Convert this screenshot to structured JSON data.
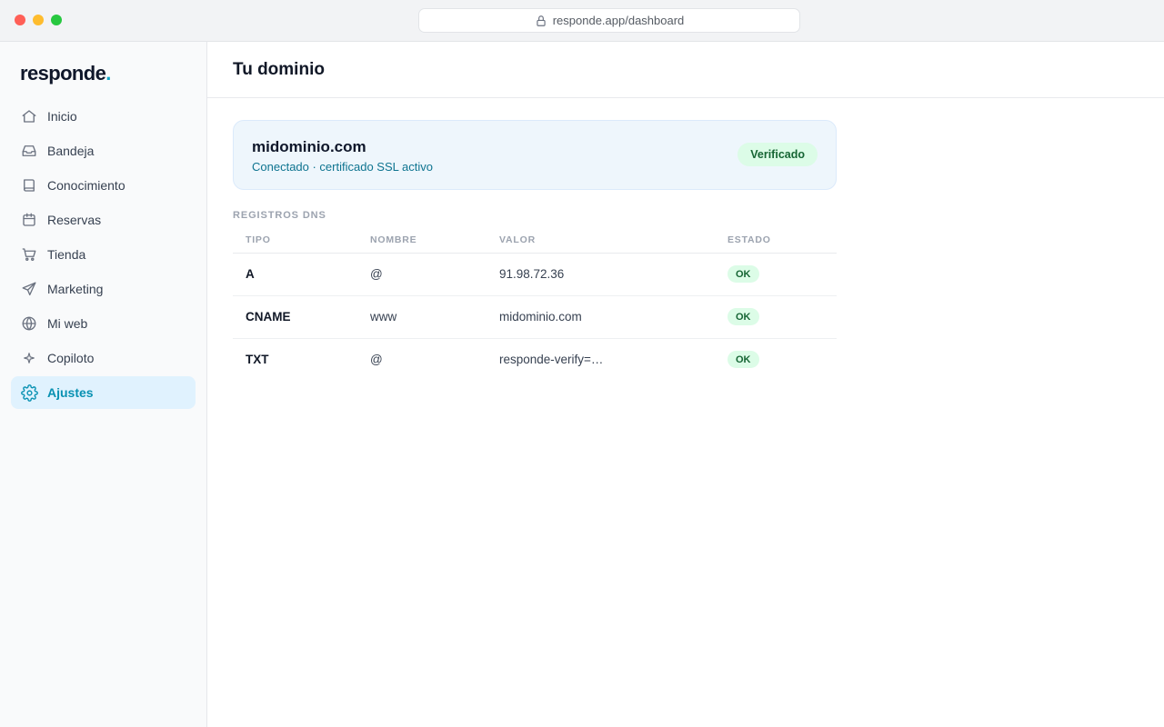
{
  "browser": {
    "url": "responde.app/dashboard",
    "lock_icon": "lock-icon"
  },
  "sidebar": {
    "logo": "responde",
    "logo_dot": ".",
    "items": [
      {
        "label": "Inicio",
        "icon": "home-icon"
      },
      {
        "label": "Bandeja",
        "icon": "inbox-icon"
      },
      {
        "label": "Conocimiento",
        "icon": "book-icon"
      },
      {
        "label": "Reservas",
        "icon": "calendar-icon"
      },
      {
        "label": "Tienda",
        "icon": "cart-icon"
      },
      {
        "label": "Marketing",
        "icon": "send-icon"
      },
      {
        "label": "Mi web",
        "icon": "globe-icon"
      },
      {
        "label": "Copiloto",
        "icon": "sparkle-icon"
      },
      {
        "label": "Ajustes",
        "icon": "gear-icon",
        "active": true
      }
    ]
  },
  "header": {
    "title": "Tu dominio"
  },
  "domain": {
    "name": "midominio.com",
    "status_text": "Conectado · certificado SSL activo",
    "badge": "Verificado"
  },
  "dns": {
    "section_title": "REGISTROS DNS",
    "columns": [
      "TIPO",
      "NOMBRE",
      "VALOR",
      "ESTADO"
    ],
    "rows": [
      {
        "type": "A",
        "name": "@",
        "value": "91.98.72.36",
        "status": "OK"
      },
      {
        "type": "CNAME",
        "name": "www",
        "value": "midominio.com",
        "status": "OK"
      },
      {
        "type": "TXT",
        "name": "@",
        "value": "responde-verify=…",
        "status": "OK"
      }
    ]
  },
  "colors": {
    "accent": "#0891b2",
    "active_bg": "#e0f2fe",
    "card_bg": "#eef6fc",
    "success_bg": "#dcfce7",
    "success_text": "#166534"
  }
}
